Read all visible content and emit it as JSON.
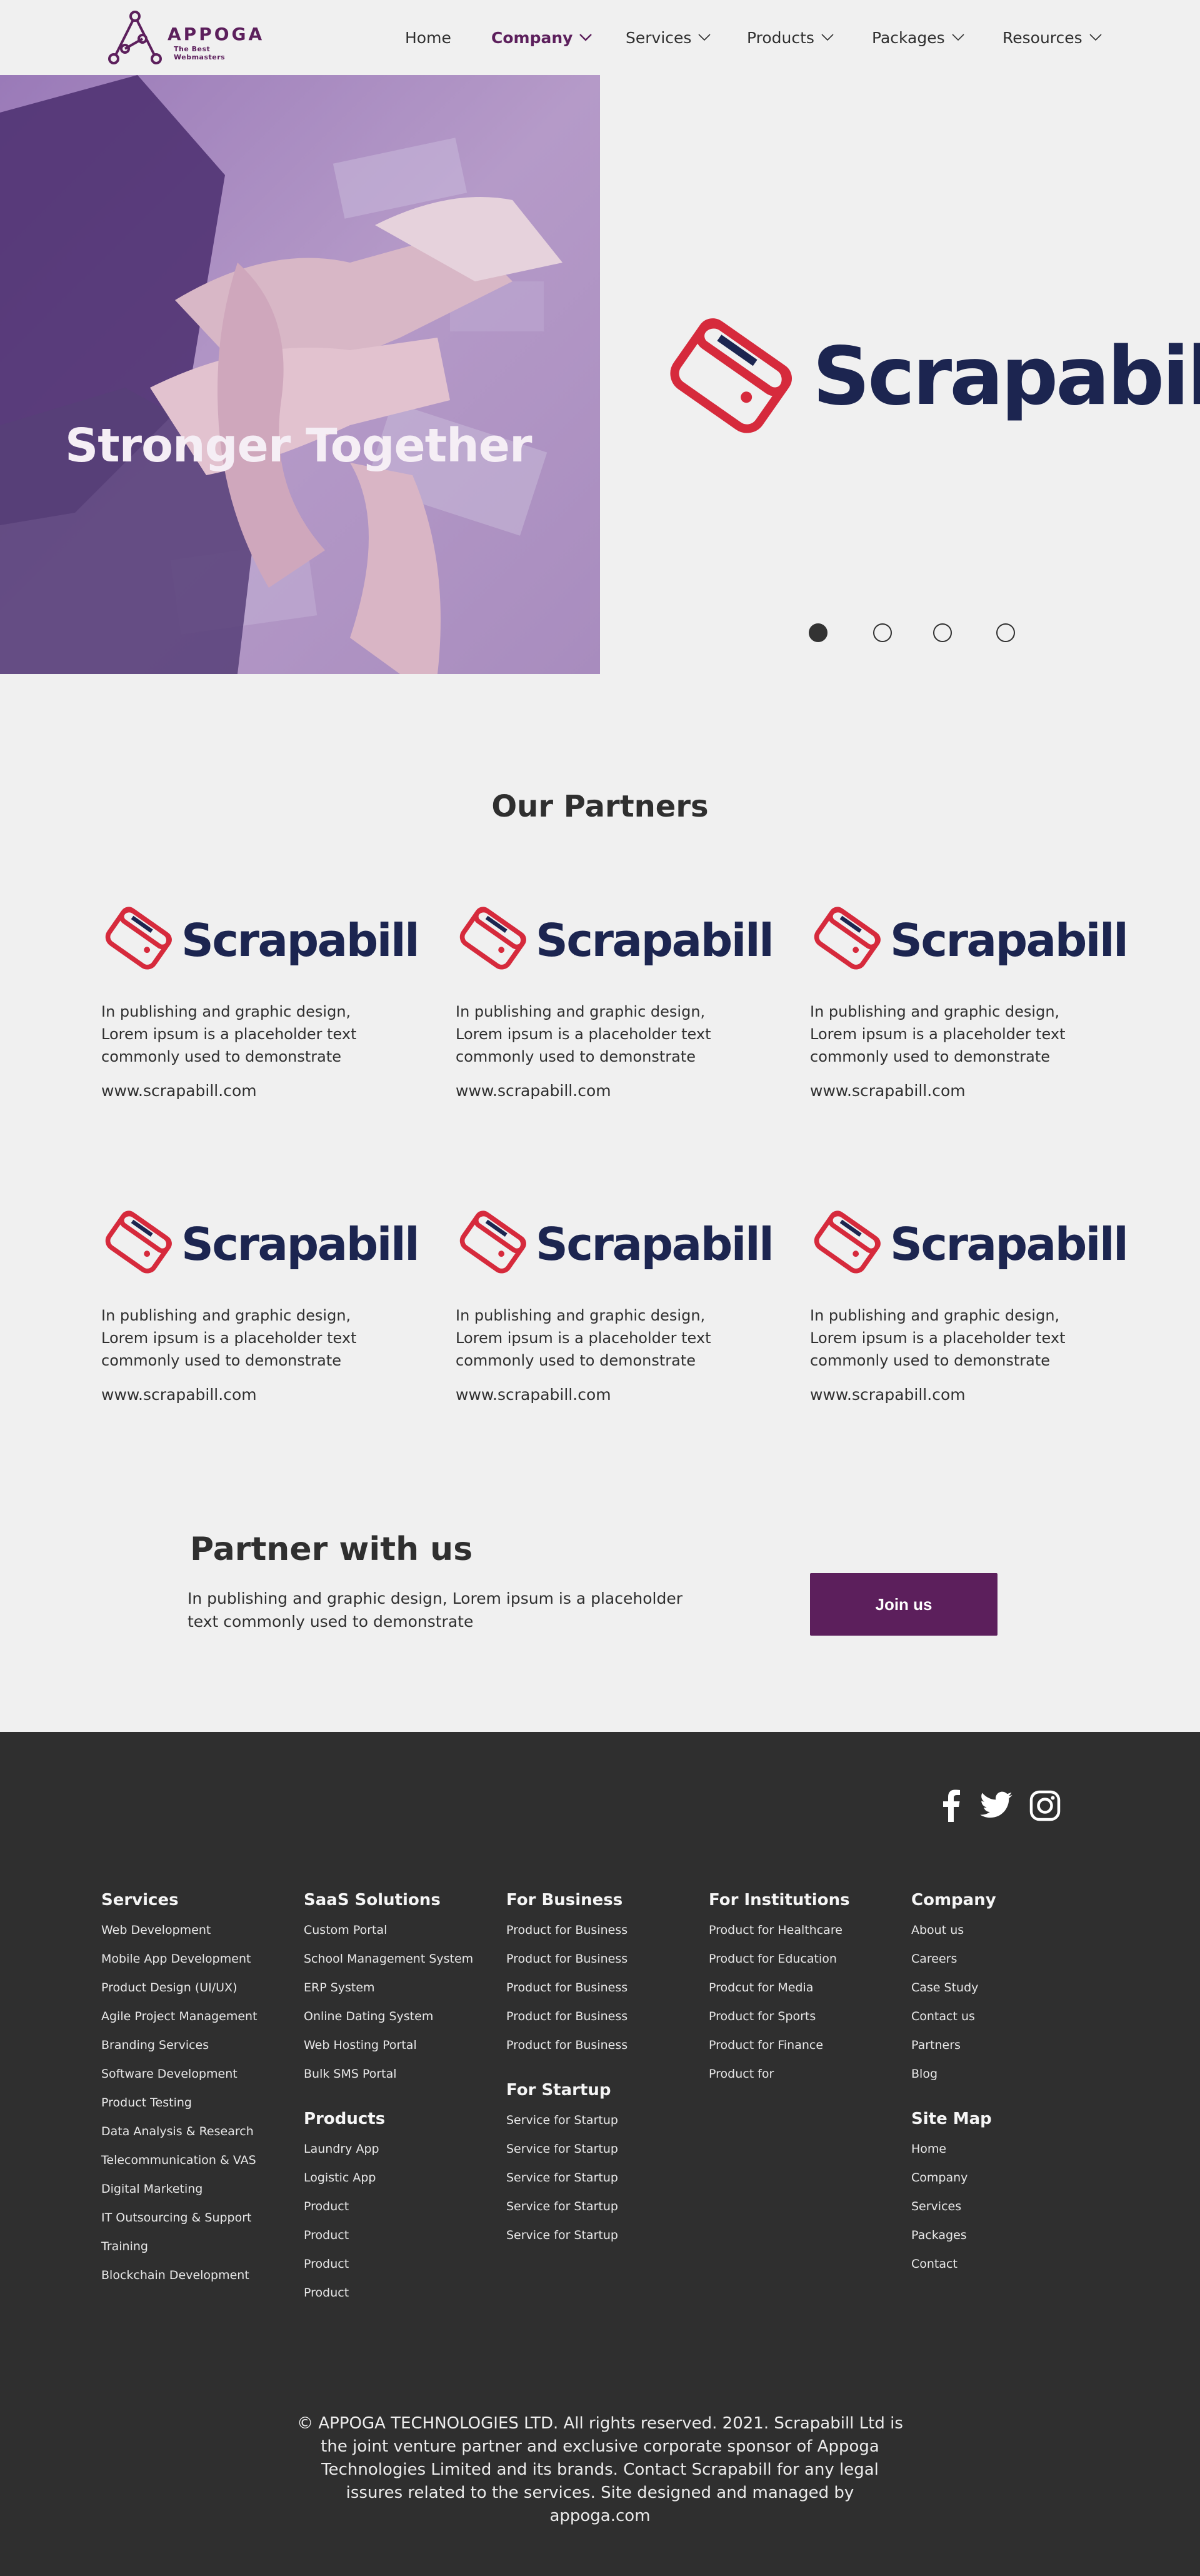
{
  "brand": {
    "name": "APPOGA",
    "tagline": "The Best Webmasters",
    "accent": "#5c1f5c",
    "navy": "#1c2550",
    "red": "#d62a3c"
  },
  "nav": {
    "items": [
      {
        "label": "Home",
        "dropdown": false,
        "active": false
      },
      {
        "label": "Company",
        "dropdown": true,
        "active": true
      },
      {
        "label": "Services",
        "dropdown": true,
        "active": false
      },
      {
        "label": "Products",
        "dropdown": true,
        "active": false
      },
      {
        "label": "Packages",
        "dropdown": true,
        "active": false
      },
      {
        "label": "Resources",
        "dropdown": true,
        "active": false
      }
    ]
  },
  "hero": {
    "title": "Stronger Together",
    "partner_logo_text": "Scrapabill",
    "slides": 4,
    "active_slide": 1
  },
  "partners": {
    "title": "Our Partners",
    "cards": [
      {
        "logo_text": "Scrapabill",
        "description": "In publishing and graphic design, Lorem ipsum is a placeholder text commonly used to demonstrate",
        "url": "www.scrapabill.com"
      },
      {
        "logo_text": "Scrapabill",
        "description": "In publishing and graphic design, Lorem ipsum is a placeholder text commonly used to demonstrate",
        "url": "www.scrapabill.com"
      },
      {
        "logo_text": "Scrapabill",
        "description": "In publishing and graphic design, Lorem ipsum is a placeholder text commonly used to demonstrate",
        "url": "www.scrapabill.com"
      },
      {
        "logo_text": "Scrapabill",
        "description": "In publishing and graphic design, Lorem ipsum is a placeholder text commonly used to demonstrate",
        "url": "www.scrapabill.com"
      },
      {
        "logo_text": "Scrapabill",
        "description": "In publishing and graphic design, Lorem ipsum is a placeholder text commonly used to demonstrate",
        "url": "www.scrapabill.com"
      },
      {
        "logo_text": "Scrapabill",
        "description": "In publishing and graphic design, Lorem ipsum is a placeholder text commonly used to demonstrate",
        "url": "www.scrapabill.com"
      }
    ]
  },
  "cta": {
    "title": "Partner with us",
    "text": "In publishing and graphic design, Lorem ipsum is a placeholder text commonly used to demonstrate",
    "button": "Join us"
  },
  "footer": {
    "social": [
      "facebook-icon",
      "twitter-icon",
      "instagram-icon"
    ],
    "columns": [
      {
        "title": "Services",
        "items": [
          "Web Development",
          "Mobile App Development",
          "Product Design (UI/UX)",
          "Agile Project Management",
          "Branding Services",
          "Software Development",
          "Product Testing",
          "Data Analysis & Research",
          "Telecommunication & VAS",
          "Digital Marketing",
          "IT Outsourcing & Support",
          "Training",
          "Blockchain Development"
        ]
      },
      {
        "title": "SaaS Solutions",
        "items": [
          "Custom Portal",
          "School Management System",
          "ERP System",
          "Online Dating System",
          "Web Hosting Portal",
          "Bulk SMS Portal"
        ]
      },
      {
        "title": "Products",
        "items": [
          "Laundry App",
          "Logistic App",
          "Product",
          "Product",
          "Product",
          "Product"
        ]
      },
      {
        "title": "For Business",
        "items": [
          "Product for Business",
          "Product for Business",
          "Product for Business",
          "Product for Business",
          "Product for Business"
        ]
      },
      {
        "title": "For Startup",
        "items": [
          "Service for Startup",
          "Service for Startup",
          "Service for Startup",
          "Service for Startup",
          "Service for Startup"
        ]
      },
      {
        "title": "For Institutions",
        "items": [
          "Product for Healthcare",
          "Product for Education",
          "Prodcut for Media",
          "Product for Sports",
          "Product for Finance",
          "Product for"
        ]
      },
      {
        "title": "Company",
        "items": [
          "About us",
          "Careers",
          "Case Study",
          "Contact us",
          "Partners",
          "Blog"
        ]
      },
      {
        "title": "Site Map",
        "items": [
          "Home",
          "Company",
          "Services",
          "Packages",
          "Contact"
        ]
      }
    ],
    "copyright": "© APPOGA TECHNOLOGIES LTD. All rights reserved. 2021. Scrapabill Ltd is the joint venture partner and exclusive corporate sponsor of Appoga Technologies Limited and its brands. Contact Scrapabill for any legal issures related to the services. Site designed and managed by appoga.com"
  }
}
